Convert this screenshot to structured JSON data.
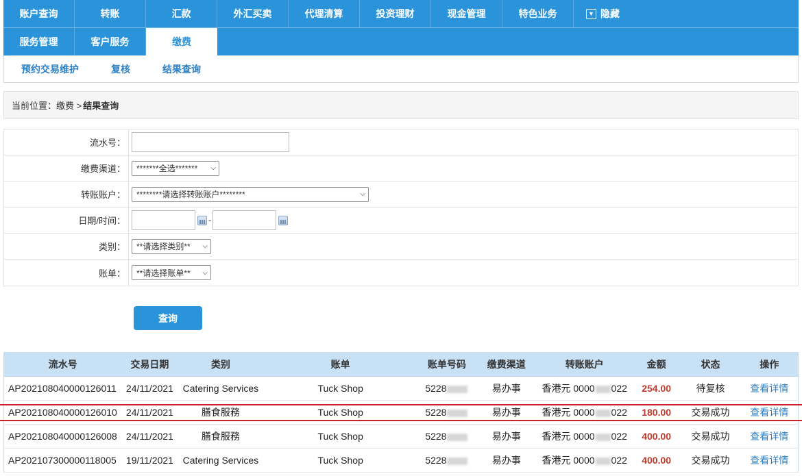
{
  "nav": {
    "row1": [
      "账户查询",
      "转账",
      "汇款",
      "外汇买卖",
      "代理清算",
      "投资理财",
      "现金管理",
      "特色业务"
    ],
    "hide_label": "隐藏",
    "row2": [
      "服务管理",
      "客户服务",
      "缴费"
    ],
    "active": "缴费"
  },
  "subnav": [
    "预约交易维护",
    "复核",
    "结果查询"
  ],
  "breadcrumb": {
    "prefix": "当前位置：缴费 > ",
    "current": "结果查询"
  },
  "form": {
    "serial_label": "流水号：",
    "serial_value": "",
    "channel_label": "缴费渠道：",
    "channel_value": "*******全选*******",
    "account_label": "转账账户：",
    "account_value": "********请选择转账账户********",
    "date_label": "日期/时间：",
    "date_from": "",
    "date_to": "",
    "category_label": "类别：",
    "category_value": "**请选择类别**",
    "bill_label": "账单：",
    "bill_value": "**请选择账单**"
  },
  "query_button": "查询",
  "table": {
    "headers": [
      "流水号",
      "交易日期",
      "类别",
      "账单",
      "账单号码",
      "缴费渠道",
      "转账账户",
      "金额",
      "状态",
      "操作"
    ],
    "rows": [
      {
        "serial": "AP202108040000126011",
        "date": "24/11/2021",
        "category": "Catering Services",
        "bill": "Tuck Shop",
        "bill_no_prefix": "5228",
        "channel": "易办事",
        "currency": "香港元",
        "acct_prefix": "0000",
        "acct_suffix": "022",
        "amount": "254.00",
        "status": "待复核",
        "action": "查看详情"
      },
      {
        "serial": "AP202108040000126010",
        "date": "24/11/2021",
        "category": "膳食服務",
        "bill": "Tuck Shop",
        "bill_no_prefix": "5228",
        "channel": "易办事",
        "currency": "香港元",
        "acct_prefix": "0000",
        "acct_suffix": "022",
        "amount": "180.00",
        "status": "交易成功",
        "action": "查看详情"
      },
      {
        "serial": "AP202108040000126008",
        "date": "24/11/2021",
        "category": "膳食服務",
        "bill": "Tuck Shop",
        "bill_no_prefix": "5228",
        "channel": "易办事",
        "currency": "香港元",
        "acct_prefix": "0000",
        "acct_suffix": "022",
        "amount": "400.00",
        "status": "交易成功",
        "action": "查看详情"
      },
      {
        "serial": "AP202107300000118005",
        "date": "19/11/2021",
        "category": "Catering Services",
        "bill": "Tuck Shop",
        "bill_no_prefix": "5228",
        "channel": "易办事",
        "currency": "香港元",
        "acct_prefix": "0000",
        "acct_suffix": "022",
        "amount": "400.00",
        "status": "交易成功",
        "action": "查看详情"
      }
    ]
  },
  "colors": {
    "brand": "#2b93d9",
    "amount": "#c0392b",
    "highlight": "#c9202a"
  }
}
